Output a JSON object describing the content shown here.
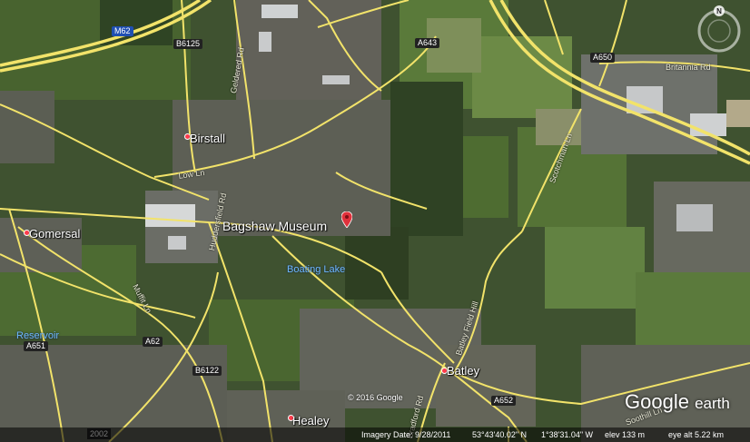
{
  "places": {
    "bagshaw": "Bagshaw Museum",
    "birstall": "Birstall",
    "gomersal": "Gomersal",
    "batley": "Batley",
    "healey": "Healey",
    "reservoir": "Reservoir",
    "boating_lake": "Boating Lake"
  },
  "roads": {
    "m62": "M62",
    "b6125": "B6125",
    "a643": "A643",
    "a650": "A650",
    "britannia": "Britannia Rd",
    "geldered": "Geldered Rd",
    "low_ln": "Low Ln",
    "huddersfield": "Huddersfield Rd",
    "scotchman": "Scotchman Ln",
    "muffit": "Muffit Ln",
    "a651": "A651",
    "a62": "A62",
    "b6122": "B6122",
    "batley_field_hill": "Batley Field Hill",
    "a652": "A652",
    "soothill": "Soothill Ln",
    "bradford": "Bradford Rd"
  },
  "badge": "2002",
  "copyright": "© 2016 Google",
  "logo": {
    "brand": "Google",
    "product": "earth"
  },
  "status": {
    "imagery_date": "Imagery Date: 9/28/2011",
    "lat": "53°43'40.02\" N",
    "lon": "1°38'31.04\" W",
    "elev": "elev  133 m",
    "eye_alt": "eye alt  5.22 km"
  },
  "compass_north": "N",
  "colors": {
    "road": "#f2e36a",
    "motorway_edge": "#d9c84a",
    "urban": "#5f6258",
    "field": "#4c6a33",
    "pin": "#e0323c"
  }
}
